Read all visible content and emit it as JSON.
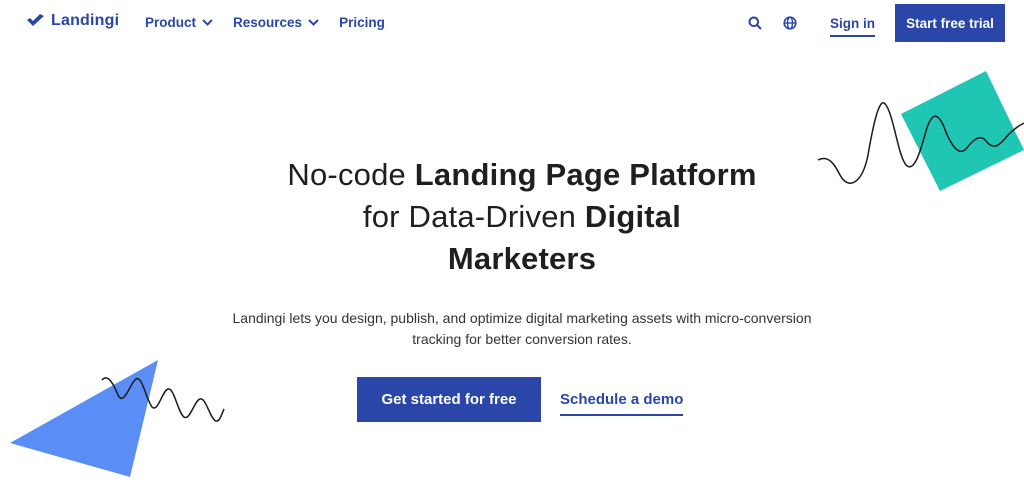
{
  "nav": {
    "logo_text": "Landingi",
    "links": [
      {
        "label": "Product",
        "has_dropdown": true
      },
      {
        "label": "Resources",
        "has_dropdown": true
      },
      {
        "label": "Pricing",
        "has_dropdown": false
      }
    ],
    "icons": [
      "search-icon",
      "globe-icon"
    ],
    "sign_in": "Sign in",
    "trial_button": "Start free trial"
  },
  "hero": {
    "headline_light_1": "No-code ",
    "headline_bold_1": "Landing Page Platform",
    "headline_light_2": "for Data-Driven ",
    "headline_bold_2": "Digital",
    "headline_bold_3": "Marketers",
    "subtext": "Landingi lets you design, publish, and optimize digital marketing assets with micro-conversion tracking for better conversion rates.",
    "primary_cta": "Get started for free",
    "secondary_cta": "Schedule a demo"
  },
  "colors": {
    "brand": "#2a46a8",
    "teal": "#1fc6b4",
    "blue_shape": "#5a8df5"
  }
}
